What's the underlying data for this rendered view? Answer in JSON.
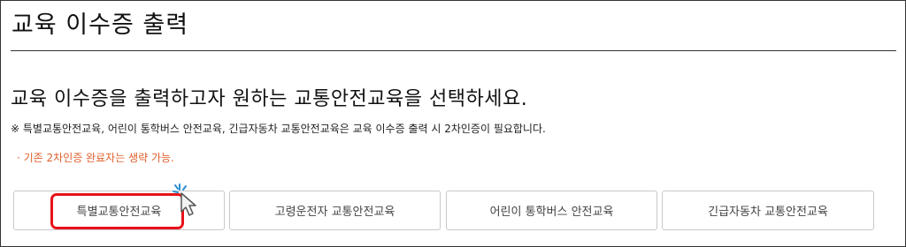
{
  "page": {
    "title": "교육 이수증 출력",
    "heading": "교육 이수증을 출력하고자 원하는 교통안전교육을 선택하세요.",
    "note": "※ 특별교통안전교육, 어린이 통학버스 안전교육, 긴급자동차 교통안전교육은 교육 이수증 출력 시 2차인증이 필요합니다.",
    "sub_note": "· 기존 2차인증 완료자는 생략 가능."
  },
  "buttons": [
    {
      "label": "특별교통안전교육"
    },
    {
      "label": "고령운전자 교통안전교육"
    },
    {
      "label": "어린이 통학버스 안전교육"
    },
    {
      "label": "긴급자동차 교통안전교육"
    }
  ],
  "colors": {
    "highlight": "#e8121a",
    "sub_note": "#e0612d",
    "cursor_sparkle": "#2b8fd6"
  },
  "icons": {
    "cursor": "pointer-cursor-icon"
  }
}
